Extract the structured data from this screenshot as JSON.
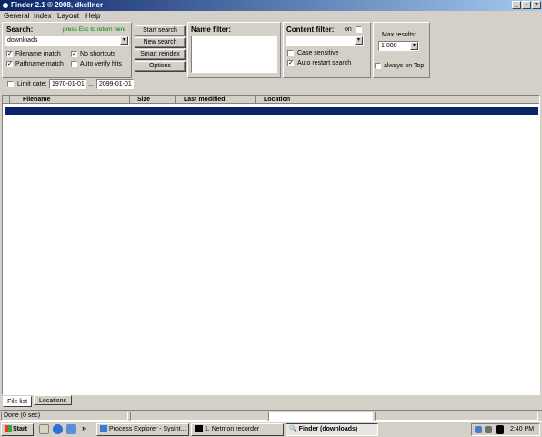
{
  "window": {
    "title": "Finder 2.1  © 2008, dkellner"
  },
  "menu": [
    "General",
    "Index",
    "Layout",
    "Help"
  ],
  "search": {
    "label": "Search:",
    "hint": "press Esc to return here",
    "value": "downloads",
    "options": [
      {
        "label": "Filename match",
        "checked": true
      },
      {
        "label": "Pathname match",
        "checked": true
      },
      {
        "label": "No shortcuts",
        "checked": true
      },
      {
        "label": "Auto verify hits",
        "checked": false
      }
    ]
  },
  "buttons": {
    "start": "Start search",
    "new": "New search",
    "reindex": "Smart reindex",
    "options": "Options"
  },
  "name_filter": {
    "label": "Name filter:"
  },
  "content_filter": {
    "label": "Content filter:",
    "on_label": "on",
    "on_checked": false,
    "case_sensitive": {
      "label": "Case sensitive",
      "checked": false
    },
    "auto_restart": {
      "label": "Auto restart search",
      "checked": true
    }
  },
  "max_results": {
    "label": "Max results:",
    "value": "1 000"
  },
  "always_on_top": {
    "label": "always on Top",
    "checked": false
  },
  "limit_date": {
    "label": "Limit date:",
    "checked": false,
    "from": "1970-01-01",
    "sep": "...",
    "to": "2099-01-01"
  },
  "results": {
    "columns": [
      "Filename",
      "Size",
      "Last modified",
      "Location"
    ]
  },
  "tabs": [
    {
      "label": "File list",
      "active": true
    },
    {
      "label": "Locations",
      "active": false
    }
  ],
  "status": {
    "text": "Done   (0 sec)"
  },
  "taskbar": {
    "start": "Start",
    "overflow": "»",
    "items": [
      {
        "label": "Process Explorer - Sysint...",
        "active": false
      },
      {
        "label": "1. Netmon recorder",
        "active": false
      },
      {
        "label": "Finder (downloads)",
        "active": true
      }
    ],
    "clock": "2:40 PM"
  },
  "colors": {
    "title_start": "#0a246a",
    "title_end": "#a6caf0",
    "selection": "#0a246a",
    "hint_green": "#008000"
  }
}
